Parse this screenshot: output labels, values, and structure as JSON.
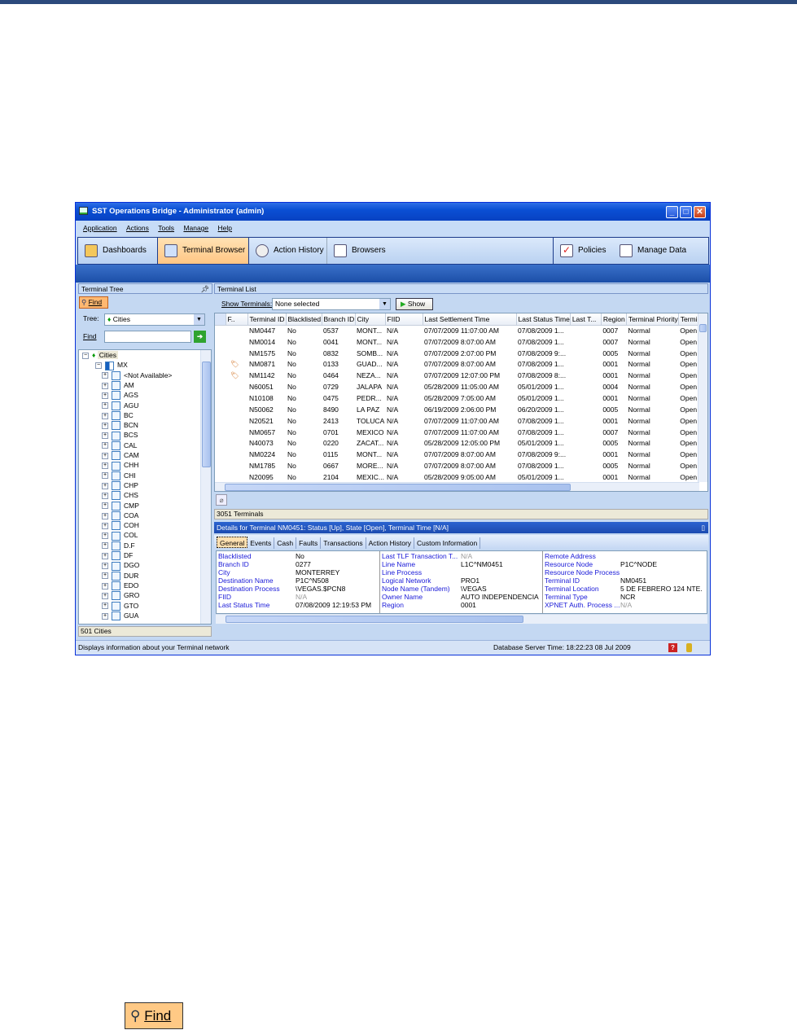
{
  "window": {
    "title": "SST Operations Bridge - Administrator (admin)"
  },
  "menu": [
    "Application",
    "Actions",
    "Tools",
    "Manage",
    "Help"
  ],
  "toolbar": {
    "dashboards": "Dashboards",
    "terminal_browser": "Terminal Browser",
    "action_history": "Action History",
    "browsers": "Browsers",
    "policies": "Policies",
    "manage_data": "Manage Data"
  },
  "tree_pane": {
    "title": "Terminal Tree",
    "find_button": "Find",
    "tree_label": "Tree:",
    "tree_value": "Cities",
    "find_label": "Find",
    "find_value": "",
    "root": "Cities",
    "country": "MX",
    "items": [
      "<Not Available>",
      "AM",
      "AGS",
      "AGU",
      "BC",
      "BCN",
      "BCS",
      "CAL",
      "CAM",
      "CHH",
      "CHI",
      "CHP",
      "CHS",
      "CMP",
      "COA",
      "COH",
      "COL",
      "D.F",
      "DF",
      "DGO",
      "DUR",
      "EDO",
      "GRO",
      "GTO",
      "GUA"
    ],
    "count": "501 Cities"
  },
  "list_pane": {
    "title": "Terminal List",
    "show_label": "Show Terminals:",
    "show_value": "None selected",
    "show_button": "Show",
    "columns": [
      "F..",
      "Terminal ID",
      "Blacklisted",
      "Branch ID",
      "City",
      "FIID",
      "Last Settlement Time",
      "Last Status Time",
      "Last T...",
      "Region",
      "Terminal Priority",
      "Termin"
    ],
    "rows": [
      {
        "flag": false,
        "id": "NM0447",
        "bl": "No",
        "branch": "0537",
        "city": "MONT...",
        "fiid": "N/A",
        "settle": "07/07/2009 11:07:00 AM",
        "status": "07/08/2009 1...",
        "lastt": "",
        "region": "0007",
        "prio": "Normal",
        "term": "Open"
      },
      {
        "flag": false,
        "id": "NM0014",
        "bl": "No",
        "branch": "0041",
        "city": "MONT...",
        "fiid": "N/A",
        "settle": "07/07/2009 8:07:00 AM",
        "status": "07/08/2009 1...",
        "lastt": "",
        "region": "0007",
        "prio": "Normal",
        "term": "Open"
      },
      {
        "flag": false,
        "id": "NM1575",
        "bl": "No",
        "branch": "0832",
        "city": "SOMB...",
        "fiid": "N/A",
        "settle": "07/07/2009 2:07:00 PM",
        "status": "07/08/2009 9:...",
        "lastt": "",
        "region": "0005",
        "prio": "Normal",
        "term": "Open"
      },
      {
        "flag": true,
        "id": "NM0871",
        "bl": "No",
        "branch": "0133",
        "city": "GUAD...",
        "fiid": "N/A",
        "settle": "07/07/2009 8:07:00 AM",
        "status": "07/08/2009 1...",
        "lastt": "",
        "region": "0001",
        "prio": "Normal",
        "term": "Open"
      },
      {
        "flag": true,
        "id": "NM1142",
        "bl": "No",
        "branch": "0464",
        "city": "NEZA...",
        "fiid": "N/A",
        "settle": "07/07/2009 12:07:00 PM",
        "status": "07/08/2009 8:...",
        "lastt": "",
        "region": "0001",
        "prio": "Normal",
        "term": "Open"
      },
      {
        "flag": false,
        "id": "N60051",
        "bl": "No",
        "branch": "0729",
        "city": "JALAPA",
        "fiid": "N/A",
        "settle": "05/28/2009 11:05:00 AM",
        "status": "05/01/2009 1...",
        "lastt": "",
        "region": "0004",
        "prio": "Normal",
        "term": "Open"
      },
      {
        "flag": false,
        "id": "N10108",
        "bl": "No",
        "branch": "0475",
        "city": "PEDR...",
        "fiid": "N/A",
        "settle": "05/28/2009 7:05:00 AM",
        "status": "05/01/2009 1...",
        "lastt": "",
        "region": "0001",
        "prio": "Normal",
        "term": "Open"
      },
      {
        "flag": false,
        "id": "N50062",
        "bl": "No",
        "branch": "8490",
        "city": "LA PAZ",
        "fiid": "N/A",
        "settle": "06/19/2009 2:06:00 PM",
        "status": "06/20/2009 1...",
        "lastt": "",
        "region": "0005",
        "prio": "Normal",
        "term": "Open"
      },
      {
        "flag": false,
        "id": "N20521",
        "bl": "No",
        "branch": "2413",
        "city": "TOLUCA",
        "fiid": "N/A",
        "settle": "07/07/2009 11:07:00 AM",
        "status": "07/08/2009 1...",
        "lastt": "",
        "region": "0001",
        "prio": "Normal",
        "term": "Open"
      },
      {
        "flag": false,
        "id": "NM0657",
        "bl": "No",
        "branch": "0701",
        "city": "MEXICO",
        "fiid": "N/A",
        "settle": "07/07/2009 11:07:00 AM",
        "status": "07/08/2009 1...",
        "lastt": "",
        "region": "0007",
        "prio": "Normal",
        "term": "Open"
      },
      {
        "flag": false,
        "id": "N40073",
        "bl": "No",
        "branch": "0220",
        "city": "ZACAT...",
        "fiid": "N/A",
        "settle": "05/28/2009 12:05:00 PM",
        "status": "05/01/2009 1...",
        "lastt": "",
        "region": "0005",
        "prio": "Normal",
        "term": "Open"
      },
      {
        "flag": false,
        "id": "NM0224",
        "bl": "No",
        "branch": "0115",
        "city": "MONT...",
        "fiid": "N/A",
        "settle": "07/07/2009 8:07:00 AM",
        "status": "07/08/2009 9:...",
        "lastt": "",
        "region": "0001",
        "prio": "Normal",
        "term": "Open"
      },
      {
        "flag": false,
        "id": "NM1785",
        "bl": "No",
        "branch": "0667",
        "city": "MORE...",
        "fiid": "N/A",
        "settle": "07/07/2009 8:07:00 AM",
        "status": "07/08/2009 1...",
        "lastt": "",
        "region": "0005",
        "prio": "Normal",
        "term": "Open"
      },
      {
        "flag": false,
        "id": "N20095",
        "bl": "No",
        "branch": "2104",
        "city": "MEXIC...",
        "fiid": "N/A",
        "settle": "05/28/2009 9:05:00 AM",
        "status": "05/01/2009 1...",
        "lastt": "",
        "region": "0001",
        "prio": "Normal",
        "term": "Open"
      }
    ],
    "count": "3051 Terminals"
  },
  "details": {
    "title": "Details for Terminal NM0451: Status [Up], State [Open], Terminal Time [N/A]",
    "tabs": [
      "General",
      "Events",
      "Cash",
      "Faults",
      "Transactions",
      "Action History",
      "Custom Information"
    ],
    "col1": [
      [
        "Blacklisted",
        "No"
      ],
      [
        "Branch ID",
        "0277"
      ],
      [
        "City",
        "MONTERREY"
      ],
      [
        "Destination Name",
        "P1C^N508"
      ],
      [
        "Destination Process",
        "\\VEGAS.$PCN8"
      ],
      [
        "FIID",
        "N/A"
      ],
      [
        "Last Status Time",
        "07/08/2009 12:19:53 PM"
      ]
    ],
    "col2": [
      [
        "Last TLF Transaction T...",
        "N/A"
      ],
      [
        "Line Name",
        "L1C^NM0451"
      ],
      [
        "Line Process",
        ""
      ],
      [
        "Logical Network",
        "PRO1"
      ],
      [
        "Node Name (Tandem)",
        "\\VEGAS"
      ],
      [
        "Owner Name",
        "AUTO INDEPENDENCIA"
      ],
      [
        "Region",
        "0001"
      ]
    ],
    "col3": [
      [
        "Remote Address",
        ""
      ],
      [
        "Resource Node",
        "P1C^NODE"
      ],
      [
        "Resource Node Process",
        ""
      ],
      [
        "Terminal ID",
        "NM0451"
      ],
      [
        "Terminal Location",
        "5 DE FEBRERO 124 NTE."
      ],
      [
        "Terminal Type",
        "NCR"
      ],
      [
        "XPNET Auth. Process ...",
        "N/A"
      ]
    ]
  },
  "status": {
    "message": "Displays information about your Terminal network",
    "server_time": "Database Server Time: 18:22:23 08 Jul 2009"
  },
  "standalone_find": "Find"
}
